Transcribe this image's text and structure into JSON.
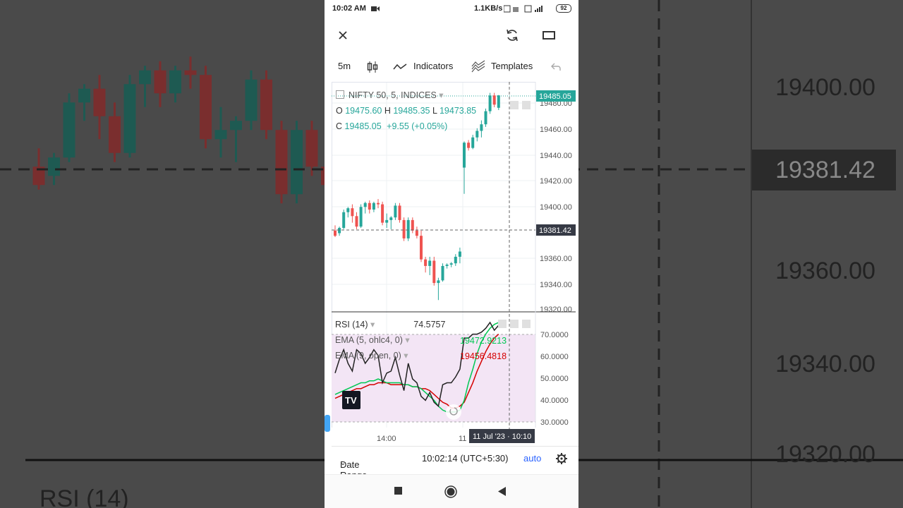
{
  "status_bar": {
    "time": "10:02 AM",
    "network_speed": "1.1KB/s",
    "battery": "92"
  },
  "app_bar": {
    "close_icon": "close-icon",
    "refresh_icon": "refresh-icon",
    "fullscreen_icon": "fullscreen-icon"
  },
  "toolbar": {
    "interval": "5m",
    "chart_type_icon": "candles-icon",
    "indicators": "Indicators",
    "templates": "Templates",
    "undo_icon": "undo-icon"
  },
  "legend": {
    "symbol": "NIFTY 50, 5, INDICES",
    "o_label": "O",
    "o_value": "19475.60",
    "h_label": "H",
    "h_value": "19485.35",
    "l_label": "L",
    "l_value": "19473.85",
    "c_label": "C",
    "c_value": "19485.05",
    "change": "+9.55 (+0.05%)"
  },
  "indicators": {
    "rsi_label": "RSI (14)",
    "rsi_value": "74.5757",
    "ema5_label": "EMA (5, ohlc4, 0)",
    "ema5_value": "19472.9213",
    "ema9_label": "EMA (9, open, 0)",
    "ema9_value": "19456.4818"
  },
  "price_axis": {
    "ticks": [
      "19480.00",
      "19460.00",
      "19440.00",
      "19420.00",
      "19400.00",
      "19380.00",
      "19360.00",
      "19340.00",
      "19320.00"
    ],
    "last_price": "19485.05",
    "crosshair_price": "19381.42"
  },
  "rsi_axis": {
    "ticks": [
      "70.0000",
      "60.0000",
      "50.0000",
      "40.0000",
      "30.0000"
    ]
  },
  "time_axis": {
    "ticks": [
      "14:00",
      "11"
    ],
    "crosshair_time": "11 Jul '23 · 10:10"
  },
  "bottom_bar": {
    "date_range": "Date Range",
    "clock": "10:02:14 (UTC+5:30)",
    "auto": "auto",
    "settings_icon": "gear-icon"
  },
  "colors": {
    "up": "#26a69a",
    "down": "#ef5350",
    "ema5": "#00c853",
    "ema9": "#d50000",
    "rsi_band": "#f3e5f5",
    "link": "#2962ff"
  },
  "background_zoom": {
    "price_ticks": [
      "19400.00",
      "19381.42",
      "19360.00",
      "19340.00",
      "19320.00"
    ],
    "rsi_label": "RSI (14)"
  },
  "chart_data": {
    "type": "candlestick",
    "price_ylim": [
      19320,
      19490
    ],
    "rsi_ylim": [
      22,
      80
    ],
    "candles": [
      {
        "o": 19382,
        "h": 19386,
        "l": 19377,
        "c": 19378
      },
      {
        "o": 19380,
        "h": 19385,
        "l": 19378,
        "c": 19384
      },
      {
        "o": 19384,
        "h": 19398,
        "l": 19383,
        "c": 19396
      },
      {
        "o": 19396,
        "h": 19400,
        "l": 19392,
        "c": 19399
      },
      {
        "o": 19399,
        "h": 19402,
        "l": 19388,
        "c": 19393
      },
      {
        "o": 19393,
        "h": 19396,
        "l": 19383,
        "c": 19385
      },
      {
        "o": 19385,
        "h": 19402,
        "l": 19384,
        "c": 19400
      },
      {
        "o": 19400,
        "h": 19404,
        "l": 19395,
        "c": 19403
      },
      {
        "o": 19403,
        "h": 19405,
        "l": 19395,
        "c": 19398
      },
      {
        "o": 19398,
        "h": 19404,
        "l": 19396,
        "c": 19403
      },
      {
        "o": 19403,
        "h": 19406,
        "l": 19399,
        "c": 19402
      },
      {
        "o": 19402,
        "h": 19404,
        "l": 19386,
        "c": 19388
      },
      {
        "o": 19388,
        "h": 19395,
        "l": 19384,
        "c": 19390
      },
      {
        "o": 19390,
        "h": 19393,
        "l": 19383,
        "c": 19392
      },
      {
        "o": 19392,
        "h": 19403,
        "l": 19390,
        "c": 19401
      },
      {
        "o": 19401,
        "h": 19403,
        "l": 19388,
        "c": 19390
      },
      {
        "o": 19390,
        "h": 19392,
        "l": 19374,
        "c": 19376
      },
      {
        "o": 19376,
        "h": 19392,
        "l": 19374,
        "c": 19390
      },
      {
        "o": 19390,
        "h": 19392,
        "l": 19380,
        "c": 19382
      },
      {
        "o": 19382,
        "h": 19385,
        "l": 19376,
        "c": 19378
      },
      {
        "o": 19378,
        "h": 19382,
        "l": 19358,
        "c": 19360
      },
      {
        "o": 19360,
        "h": 19362,
        "l": 19350,
        "c": 19355
      },
      {
        "o": 19355,
        "h": 19362,
        "l": 19348,
        "c": 19359
      },
      {
        "o": 19359,
        "h": 19362,
        "l": 19340,
        "c": 19342
      },
      {
        "o": 19342,
        "h": 19346,
        "l": 19329,
        "c": 19344
      },
      {
        "o": 19344,
        "h": 19357,
        "l": 19343,
        "c": 19355
      },
      {
        "o": 19355,
        "h": 19357,
        "l": 19353,
        "c": 19356
      },
      {
        "o": 19356,
        "h": 19358,
        "l": 19354,
        "c": 19357
      },
      {
        "o": 19357,
        "h": 19364,
        "l": 19355,
        "c": 19362
      },
      {
        "o": 19362,
        "h": 19369,
        "l": 19357,
        "c": 19366
      },
      {
        "o": 19430,
        "h": 19450,
        "l": 19410,
        "c": 19449
      },
      {
        "o": 19449,
        "h": 19451,
        "l": 19443,
        "c": 19445
      },
      {
        "o": 19445,
        "h": 19455,
        "l": 19444,
        "c": 19453
      },
      {
        "o": 19453,
        "h": 19460,
        "l": 19450,
        "c": 19458
      },
      {
        "o": 19458,
        "h": 19466,
        "l": 19453,
        "c": 19463
      },
      {
        "o": 19463,
        "h": 19475,
        "l": 19461,
        "c": 19473
      },
      {
        "o": 19473,
        "h": 19487,
        "l": 19471,
        "c": 19485
      },
      {
        "o": 19485,
        "h": 19487,
        "l": 19476,
        "c": 19478
      },
      {
        "o": 19475.6,
        "h": 19485.35,
        "l": 19473.85,
        "c": 19485.05
      }
    ],
    "rsi": [
      50,
      57,
      62,
      55,
      51,
      62,
      60,
      55,
      58,
      62,
      59,
      45,
      50,
      51,
      58,
      49,
      41,
      55,
      47,
      45,
      38,
      36,
      40,
      35,
      33,
      44,
      45,
      45,
      48,
      52,
      68,
      68,
      70,
      70,
      71,
      73,
      76,
      72,
      74.58
    ],
    "ema5": [
      39,
      40,
      41,
      42,
      43,
      44,
      45,
      45,
      46,
      46,
      47,
      46,
      45,
      45,
      45,
      45,
      44,
      44,
      43,
      43,
      42,
      40,
      38,
      36,
      33,
      31,
      30,
      30,
      30,
      31,
      36,
      45,
      52,
      60,
      66,
      70,
      73,
      75,
      76
    ],
    "ema9": [
      37,
      38,
      39,
      40,
      41,
      42,
      42,
      43,
      44,
      44,
      45,
      45,
      45,
      44,
      44,
      44,
      44,
      44,
      43,
      43,
      42,
      42,
      41,
      39,
      37,
      35,
      34,
      32,
      32,
      33,
      35,
      40,
      45,
      51,
      56,
      61,
      65,
      68,
      70
    ]
  }
}
